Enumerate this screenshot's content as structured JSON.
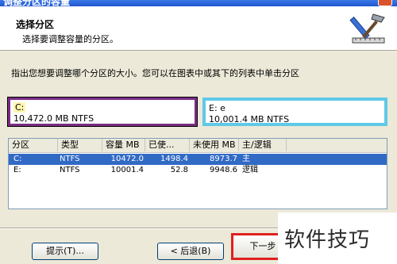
{
  "window": {
    "title": "调整分区的容量"
  },
  "header": {
    "title": "选择分区",
    "subtitle": "选择要调整容量的分区。",
    "icon": "ruler-tool-icon"
  },
  "instruction": "指出您想要调整哪个分区的大小。您可以在图表中或其下的列表中单击分区",
  "partitions_visual": [
    {
      "name": "C:",
      "info": "10,472.0 MB   NTFS"
    },
    {
      "name": "E:  e",
      "info": "10,001.4 MB   NTFS"
    }
  ],
  "table": {
    "headers": [
      "分区",
      "类型",
      "容量 MB",
      "已使...",
      "未使用 MB",
      "主/逻辑"
    ],
    "rows": [
      [
        "C:",
        "NTFS",
        "10472.0",
        "1498.4",
        "8973.7",
        "主"
      ],
      [
        "E:",
        "NTFS",
        "10001.4",
        "52.8",
        "9948.6",
        "逻辑"
      ]
    ]
  },
  "buttons": {
    "hint": "提示(T)...",
    "back": "< 后退(B)",
    "next": "下一步"
  },
  "watermark": "软件技巧",
  "colors": {
    "selected_row": "#316ac5",
    "partition_c_border": "#7b2c84",
    "partition_e_border": "#5fc9e8",
    "highlight_next": "#e02020"
  }
}
